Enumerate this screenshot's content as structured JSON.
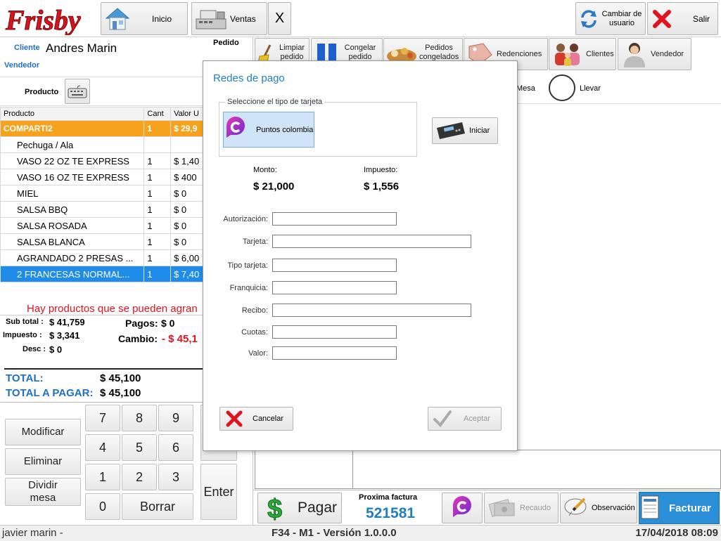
{
  "brand": {
    "name": "Frisby",
    "color": "#d7141e"
  },
  "topbar": {
    "inicio_label": "Inicio",
    "ventas_label": "Ventas",
    "close_label": "X",
    "cambiar_usuario_label": "Cambiar de usuario",
    "salir_label": "Salir"
  },
  "toolbar2": {
    "limpiar_label": "Limpiar pedido",
    "congelar_label": "Congelar pedido",
    "pedidos_congelados_label": "Pedidos congelados",
    "redenciones_label": "Redenciones",
    "clientes_label": "Clientes",
    "vendedor_label": "Vendedor"
  },
  "order": {
    "cliente_label": "Cliente",
    "cliente_name": "Andres Marin",
    "vendedor_label": "Vendedor",
    "pedido_label": "Pedido",
    "producto_label": "Producto",
    "mesa_label": "Mesa",
    "llevar_label": "Llevar",
    "columns": [
      "Producto",
      "Cant",
      "Valor U"
    ],
    "rows": [
      {
        "name": "COMPARTI2",
        "qty": "1",
        "price": "$ 29,9"
      },
      {
        "name": "Pechuga / Ala",
        "qty": "",
        "price": ""
      },
      {
        "name": "VASO 22 OZ TE EXPRESS",
        "qty": "1",
        "price": "$ 1,40"
      },
      {
        "name": "VASO 16 OZ TE EXPRESS",
        "qty": "1",
        "price": "$ 400"
      },
      {
        "name": "MIEL",
        "qty": "1",
        "price": "$ 0"
      },
      {
        "name": "SALSA BBQ",
        "qty": "1",
        "price": "$ 0"
      },
      {
        "name": "SALSA ROSADA",
        "qty": "1",
        "price": "$ 0"
      },
      {
        "name": "SALSA BLANCA",
        "qty": "1",
        "price": "$ 0"
      },
      {
        "name": "AGRANDADO 2 PRESAS ...",
        "qty": "1",
        "price": "$ 6,00"
      },
      {
        "name": "2 FRANCESAS NORMAL...",
        "qty": "1",
        "price": "$ 7,40"
      }
    ],
    "warning": "Hay productos que se pueden agran",
    "subtotal_label": "Sub total :",
    "subtotal_value": "$ 41,759",
    "impuesto_label": "Impuesto :",
    "impuesto_value": "$ 3,341",
    "desc_label": "Desc :",
    "desc_value": "$ 0",
    "pagos_label": "Pagos:",
    "pagos_value": "$ 0",
    "cambio_label": "Cambio:",
    "cambio_value": "- $ 45,1",
    "total_label": "TOTAL:",
    "total_value": "$ 45,100",
    "total_pagar_label": "TOTAL A PAGAR:",
    "total_pagar_value": "$ 45,100"
  },
  "keypad": {
    "keys": [
      "7",
      "8",
      "9",
      "4",
      "5",
      "6",
      "1",
      "2",
      "3",
      "0"
    ],
    "borrar_label": "Borrar",
    "enter_label": "Enter",
    "modificar_label": "Modificar",
    "eliminar_label": "Eliminar",
    "dividir_label": "Dividir mesa"
  },
  "bottom": {
    "pagar_label": "Pagar",
    "proxima_factura_label": "Proxima factura",
    "proxima_factura_value": "521581",
    "recaudo_label": "Recaudo",
    "observacion_label": "Observación",
    "facturar_label": "Facturar"
  },
  "modal": {
    "title": "Redes de pago",
    "group_label": "Seleccione el tipo de tarjeta",
    "card_option_label": "Puntos colombia",
    "iniciar_label": "Iniciar",
    "monto_label": "Monto:",
    "monto_value": "$ 21,000",
    "impuesto_label": "Impuesto:",
    "impuesto_value": "$ 1,556",
    "fields": {
      "autorizacion": "Autorización:",
      "tarjeta": "Tarjeta:",
      "tipo_tarjeta": "Tipo tarjeta:",
      "franquicia": "Franquicia:",
      "recibo": "Recibo:",
      "cuotas": "Cuotas:",
      "valor": "Valor:"
    },
    "cancelar_label": "Cancelar",
    "aceptar_label": "Aceptar"
  },
  "status": {
    "user": "javier marin -",
    "center": "F34 - M1 - Versión 1.0.0.0",
    "datetime": "17/04/2018 08:09"
  },
  "colors": {
    "accent_blue": "#1f6fc5",
    "selected_row": "#1e8ce8",
    "parent_row": "#f7a21c",
    "facturar_bg": "#2b8fd8",
    "danger_red": "#e0141e",
    "puntos_purple": "#8e2bd1"
  }
}
